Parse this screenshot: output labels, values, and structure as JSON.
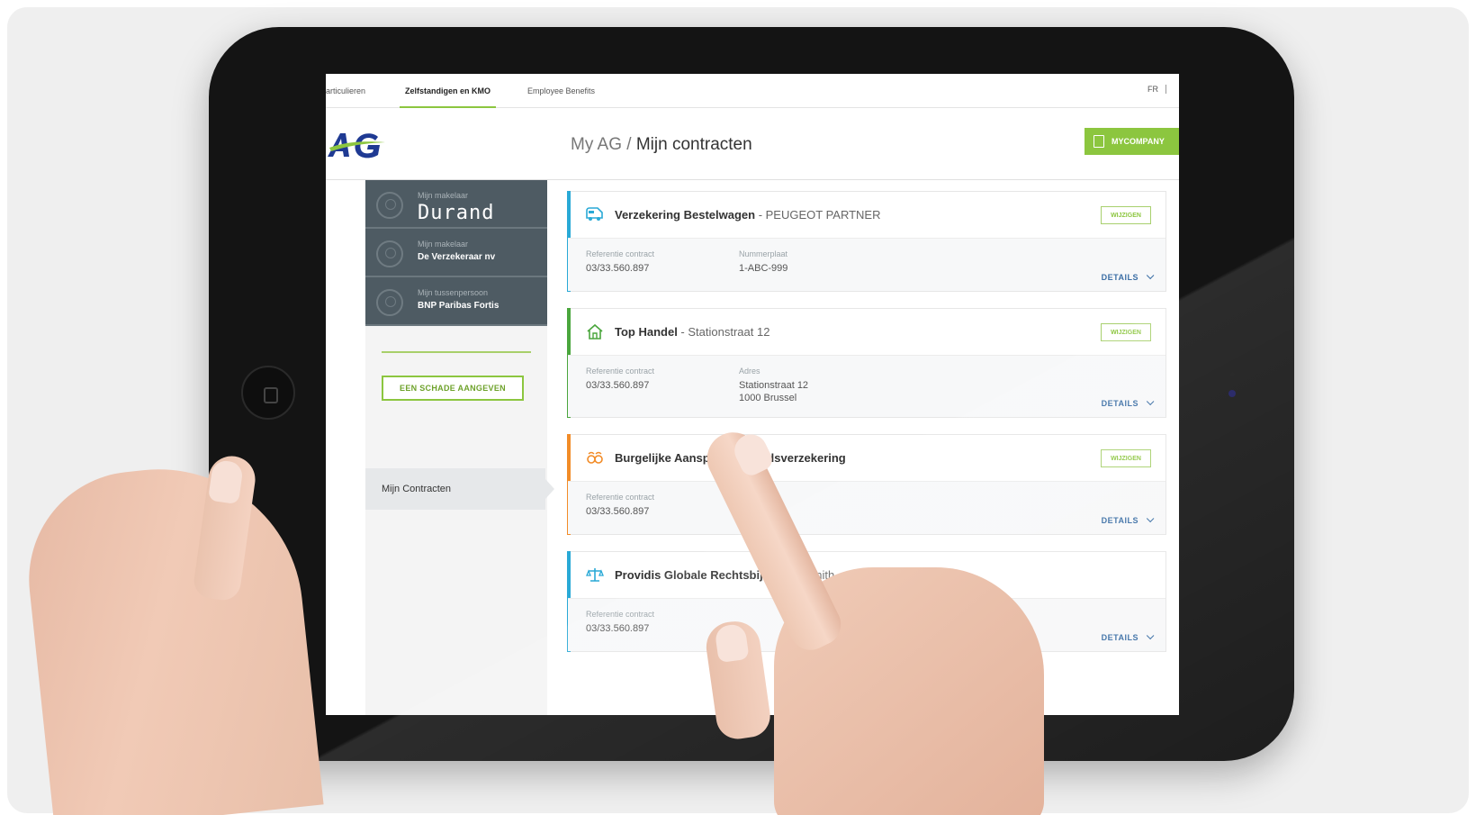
{
  "topbar": {
    "tabs": [
      {
        "label": "articulieren"
      },
      {
        "label": "Zelfstandigen en KMO",
        "active": true
      },
      {
        "label": "Employee Benefits"
      }
    ],
    "lang": "FR"
  },
  "header": {
    "breadcrumb_root": "My AG",
    "breadcrumb_sep": " / ",
    "breadcrumb_current": "Mijn contracten",
    "company_button": "MYCOMPANY"
  },
  "sidebar": {
    "contacts": [
      {
        "label": "Mijn makelaar",
        "name": "Durand"
      },
      {
        "label": "Mijn makelaar",
        "name": "De Verzekeraar nv"
      },
      {
        "label": "Mijn tussenpersoon",
        "name": "BNP Paribas Fortis"
      }
    ],
    "claim_button": "EEN SCHADE AANGEVEN",
    "nav": [
      {
        "label": "Mijn Contracten"
      }
    ]
  },
  "contracts": [
    {
      "title": "Verzekering Bestelwagen",
      "subtitle": " - PEUGEOT PARTNER",
      "accent": "#29a9d6",
      "icon": "van-icon",
      "modify": "WIJZIGEN",
      "fields": [
        {
          "label": "Referentie contract",
          "value": "03/33.560.897"
        },
        {
          "label": "Nummerplaat",
          "value": "1-ABC-999"
        }
      ],
      "details": "DETAILS"
    },
    {
      "title": "Top Handel",
      "subtitle": " - Stationstraat 12",
      "accent": "#4aa63d",
      "icon": "house-icon",
      "modify": "WIJZIGEN",
      "fields": [
        {
          "label": "Referentie contract",
          "value": "03/33.560.897"
        },
        {
          "label": "Adres",
          "value": "Stationstraat 12",
          "value2": "1000 Brussel"
        }
      ],
      "details": "DETAILS"
    },
    {
      "title": "Burgelijke Aansprakelijkheidsverzekering",
      "subtitle": "",
      "accent": "#f28c28",
      "icon": "people-icon",
      "modify": "WIJZIGEN",
      "fields": [
        {
          "label": "Referentie contract",
          "value": "03/33.560.897"
        }
      ],
      "details": "DETAILS"
    },
    {
      "title": "Providis Globale Rechtsbijstand",
      "subtitle": " - Smith",
      "accent": "#29a9d6",
      "icon": "scales-icon",
      "modify": "",
      "fields": [
        {
          "label": "Referentie contract",
          "value": "03/33.560.897"
        }
      ],
      "details": "DETAILS"
    }
  ],
  "colors": {
    "brand_green": "#8cc63f",
    "sidebar_dark": "#4e5b63",
    "logo_blue": "#1f3a93"
  }
}
